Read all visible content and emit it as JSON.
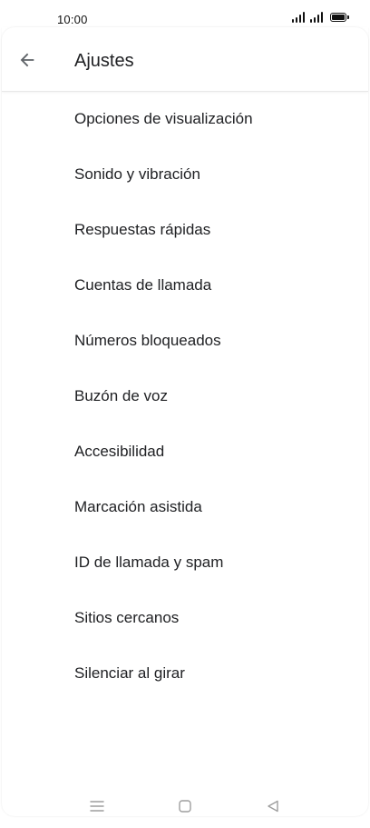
{
  "status_bar": {
    "time": "10:00",
    "icons": [
      "signal-icon",
      "signal-icon",
      "battery-icon"
    ]
  },
  "header": {
    "back_icon": "arrow-left-icon",
    "title": "Ajustes"
  },
  "settings": {
    "items": [
      {
        "label": "Opciones de visualización"
      },
      {
        "label": "Sonido y vibración"
      },
      {
        "label": "Respuestas rápidas"
      },
      {
        "label": "Cuentas de llamada"
      },
      {
        "label": "Números bloqueados"
      },
      {
        "label": "Buzón de voz"
      },
      {
        "label": "Accesibilidad"
      },
      {
        "label": "Marcación asistida"
      },
      {
        "label": "ID de llamada y spam"
      },
      {
        "label": "Sitios cercanos"
      },
      {
        "label": "Silenciar al girar"
      }
    ]
  },
  "nav_bar": {
    "icons": [
      "menu-icon",
      "home-icon",
      "back-triangle-icon"
    ]
  },
  "colors": {
    "text": "#202124",
    "background": "#ffffff",
    "nav_icon": "#9e9e9e"
  }
}
